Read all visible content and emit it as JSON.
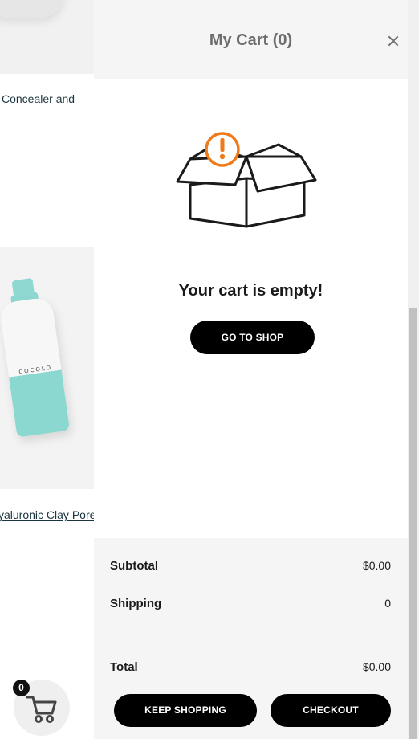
{
  "background": {
    "product_link_1": "Concealer and",
    "product_link_2": "yaluronic Clay Pore",
    "bottle_brand": "COCOLO",
    "cart_fab": {
      "count": "0",
      "icon": "cart-icon"
    }
  },
  "drawer": {
    "title": "My Cart (0)",
    "close_icon": "close-icon",
    "empty_icon": "open-box-alert-icon",
    "empty_message": "Your cart is empty!",
    "go_to_shop_label": "GO TO SHOP",
    "summary": {
      "subtotal_label": "Subtotal",
      "subtotal_value": "$0.00",
      "shipping_label": "Shipping",
      "shipping_value": "0",
      "total_label": "Total",
      "total_value": "$0.00"
    },
    "keep_shopping_label": "KEEP SHOPPING",
    "checkout_label": "CHECKOUT"
  },
  "colors": {
    "accent": "#f07a1a",
    "button_bg": "#000000",
    "header_bg": "#f5f5f5"
  }
}
